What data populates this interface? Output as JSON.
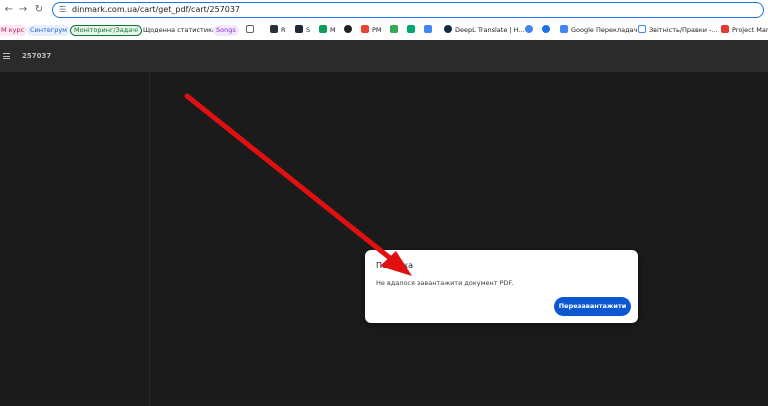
{
  "browser": {
    "url": "dinmark.com.ua/cart/get_pdf/cart/257037",
    "bookmarks": [
      {
        "label": "M курс",
        "bg": "#fce8f3",
        "color": "#c2185b"
      },
      {
        "label": "Синтегрум",
        "bg": "#e8f0fe",
        "color": "#1967d2"
      },
      {
        "label": "Моніторинг/Задачі",
        "bg": "#e6f4ea",
        "color": "#137333"
      },
      {
        "label": "Щоденна статистика",
        "bg": "#ffffff",
        "color": "#202124"
      },
      {
        "label": "Songs",
        "bg": "#f3e8fd",
        "color": "#8430ce"
      },
      {
        "label": "R"
      },
      {
        "label": "S"
      },
      {
        "label": "M"
      },
      {
        "label": "PM"
      },
      {
        "label": "DeepL Translate | H..."
      },
      {
        "label": "Google Перекладач"
      },
      {
        "label": "Звітність/Правки -..."
      },
      {
        "label": "Project Mana"
      }
    ]
  },
  "pdf_viewer": {
    "title": "257037"
  },
  "dialog": {
    "title": "Помилка",
    "message": "Не вдалося завантажити документ PDF.",
    "reload_label": "Перезавантажити",
    "reload_color": "#0b57d0"
  },
  "annotation": {
    "arrow_color": "#e01010"
  }
}
